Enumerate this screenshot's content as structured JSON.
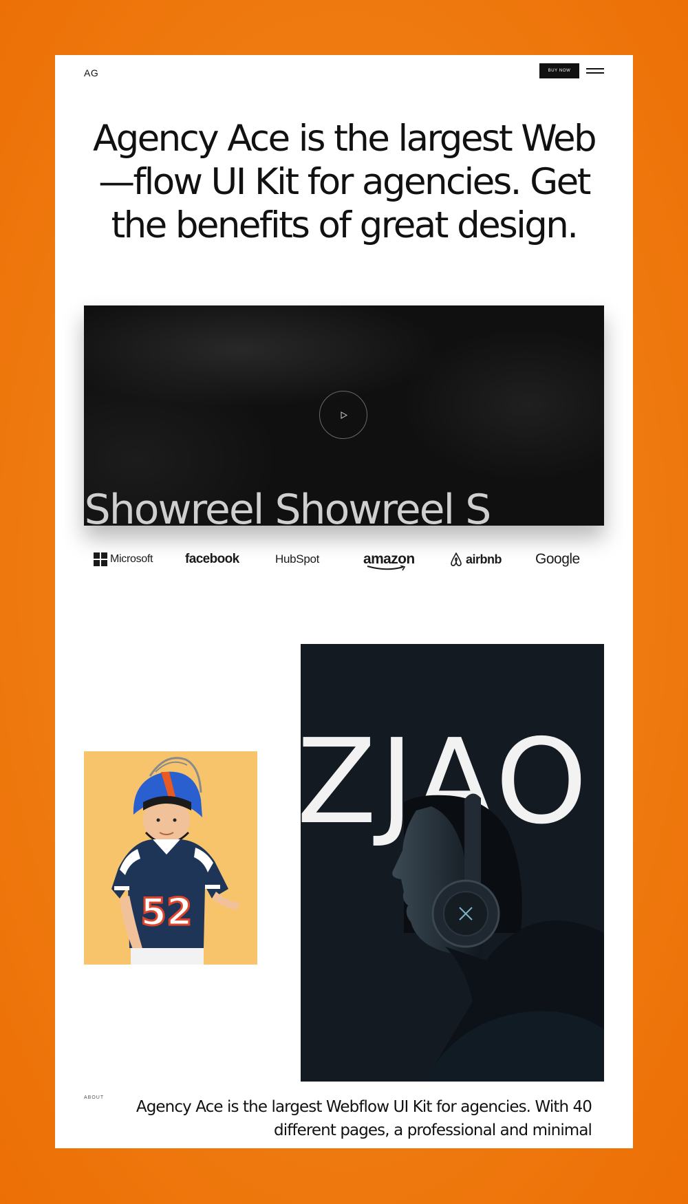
{
  "header": {
    "logo": "AG",
    "buy_label": "BUY NOW",
    "menu_icon": "hamburger-menu-icon"
  },
  "hero": {
    "title": "Agency Ace is the largest Web—flow UI Kit for agencies. Get the benefits of great design."
  },
  "video": {
    "marquee_text": "el Showreel Showreel S",
    "play_icon": "play-icon"
  },
  "logos": {
    "microsoft": "Microsoft",
    "facebook": "facebook",
    "hubspot": "HubSpot",
    "amazon": "amazon",
    "airbnb": "airbnb",
    "google": "Google"
  },
  "images": {
    "kid_jersey_number": "52",
    "poster_text": "ZJAO"
  },
  "about": {
    "label": "ABOUT",
    "text": "Agency Ace is the largest Webflow UI Kit for agencies. With 40 different pages, a professional and minimal"
  },
  "colors": {
    "background": "#f07f14",
    "card": "#ffffff",
    "video_bg": "#101010",
    "poster_bg": "#131a22",
    "kid_bg": "#f7c46c"
  }
}
